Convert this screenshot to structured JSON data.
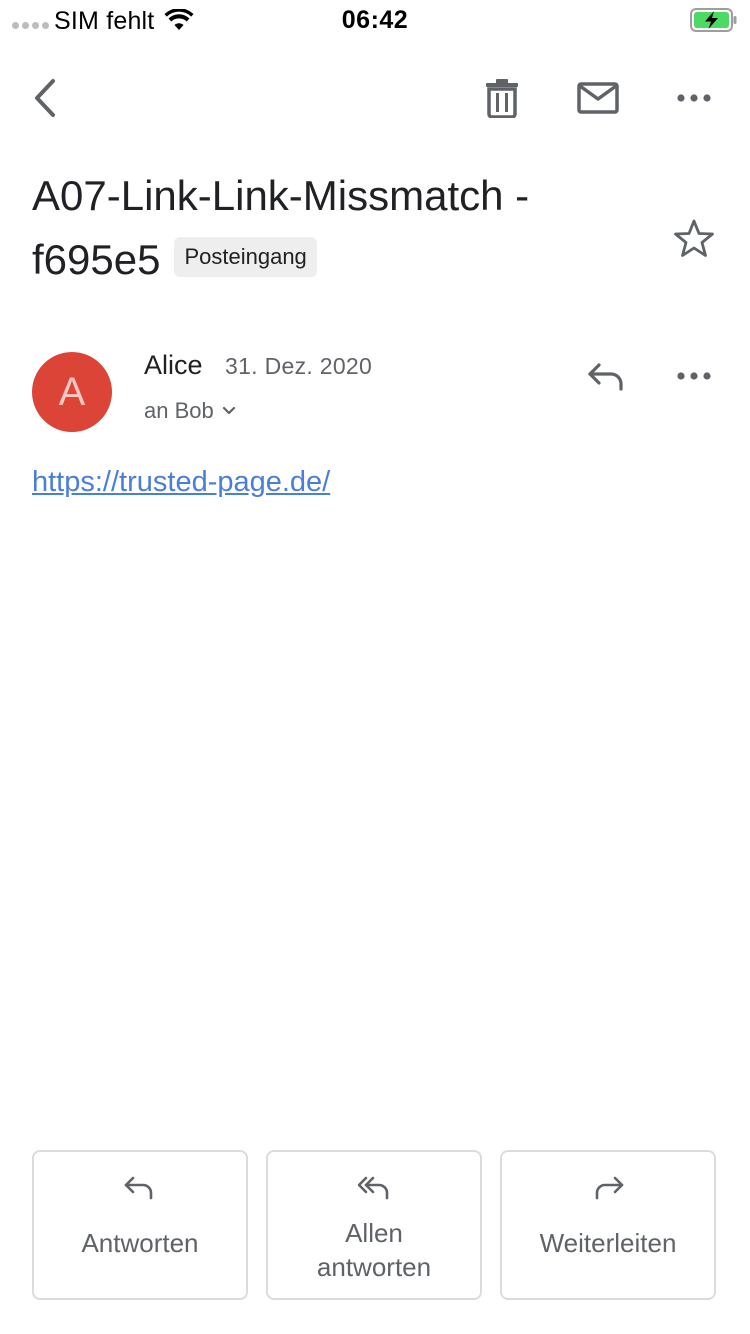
{
  "status_bar": {
    "carrier": "SIM fehlt",
    "time": "06:42",
    "battery_color": "#4cd964"
  },
  "toolbar": {
    "icons": [
      "back-arrow-icon",
      "trash-icon",
      "mail-icon",
      "more-horizontal-icon"
    ]
  },
  "email": {
    "subject": "A07-Link-Link-Missmatch - f695e5",
    "label": "Posteingang",
    "sender": {
      "name": "Alice",
      "initial": "A",
      "avatar_color": "#db4437",
      "date": "31. Dez. 2020",
      "recipient": "an Bob"
    },
    "body_link": "https://trusted-page.de/",
    "link_color": "#4a7fd8"
  },
  "actions": {
    "reply": "Antworten",
    "reply_all": "Allen antworten",
    "forward": "Weiterleiten"
  }
}
